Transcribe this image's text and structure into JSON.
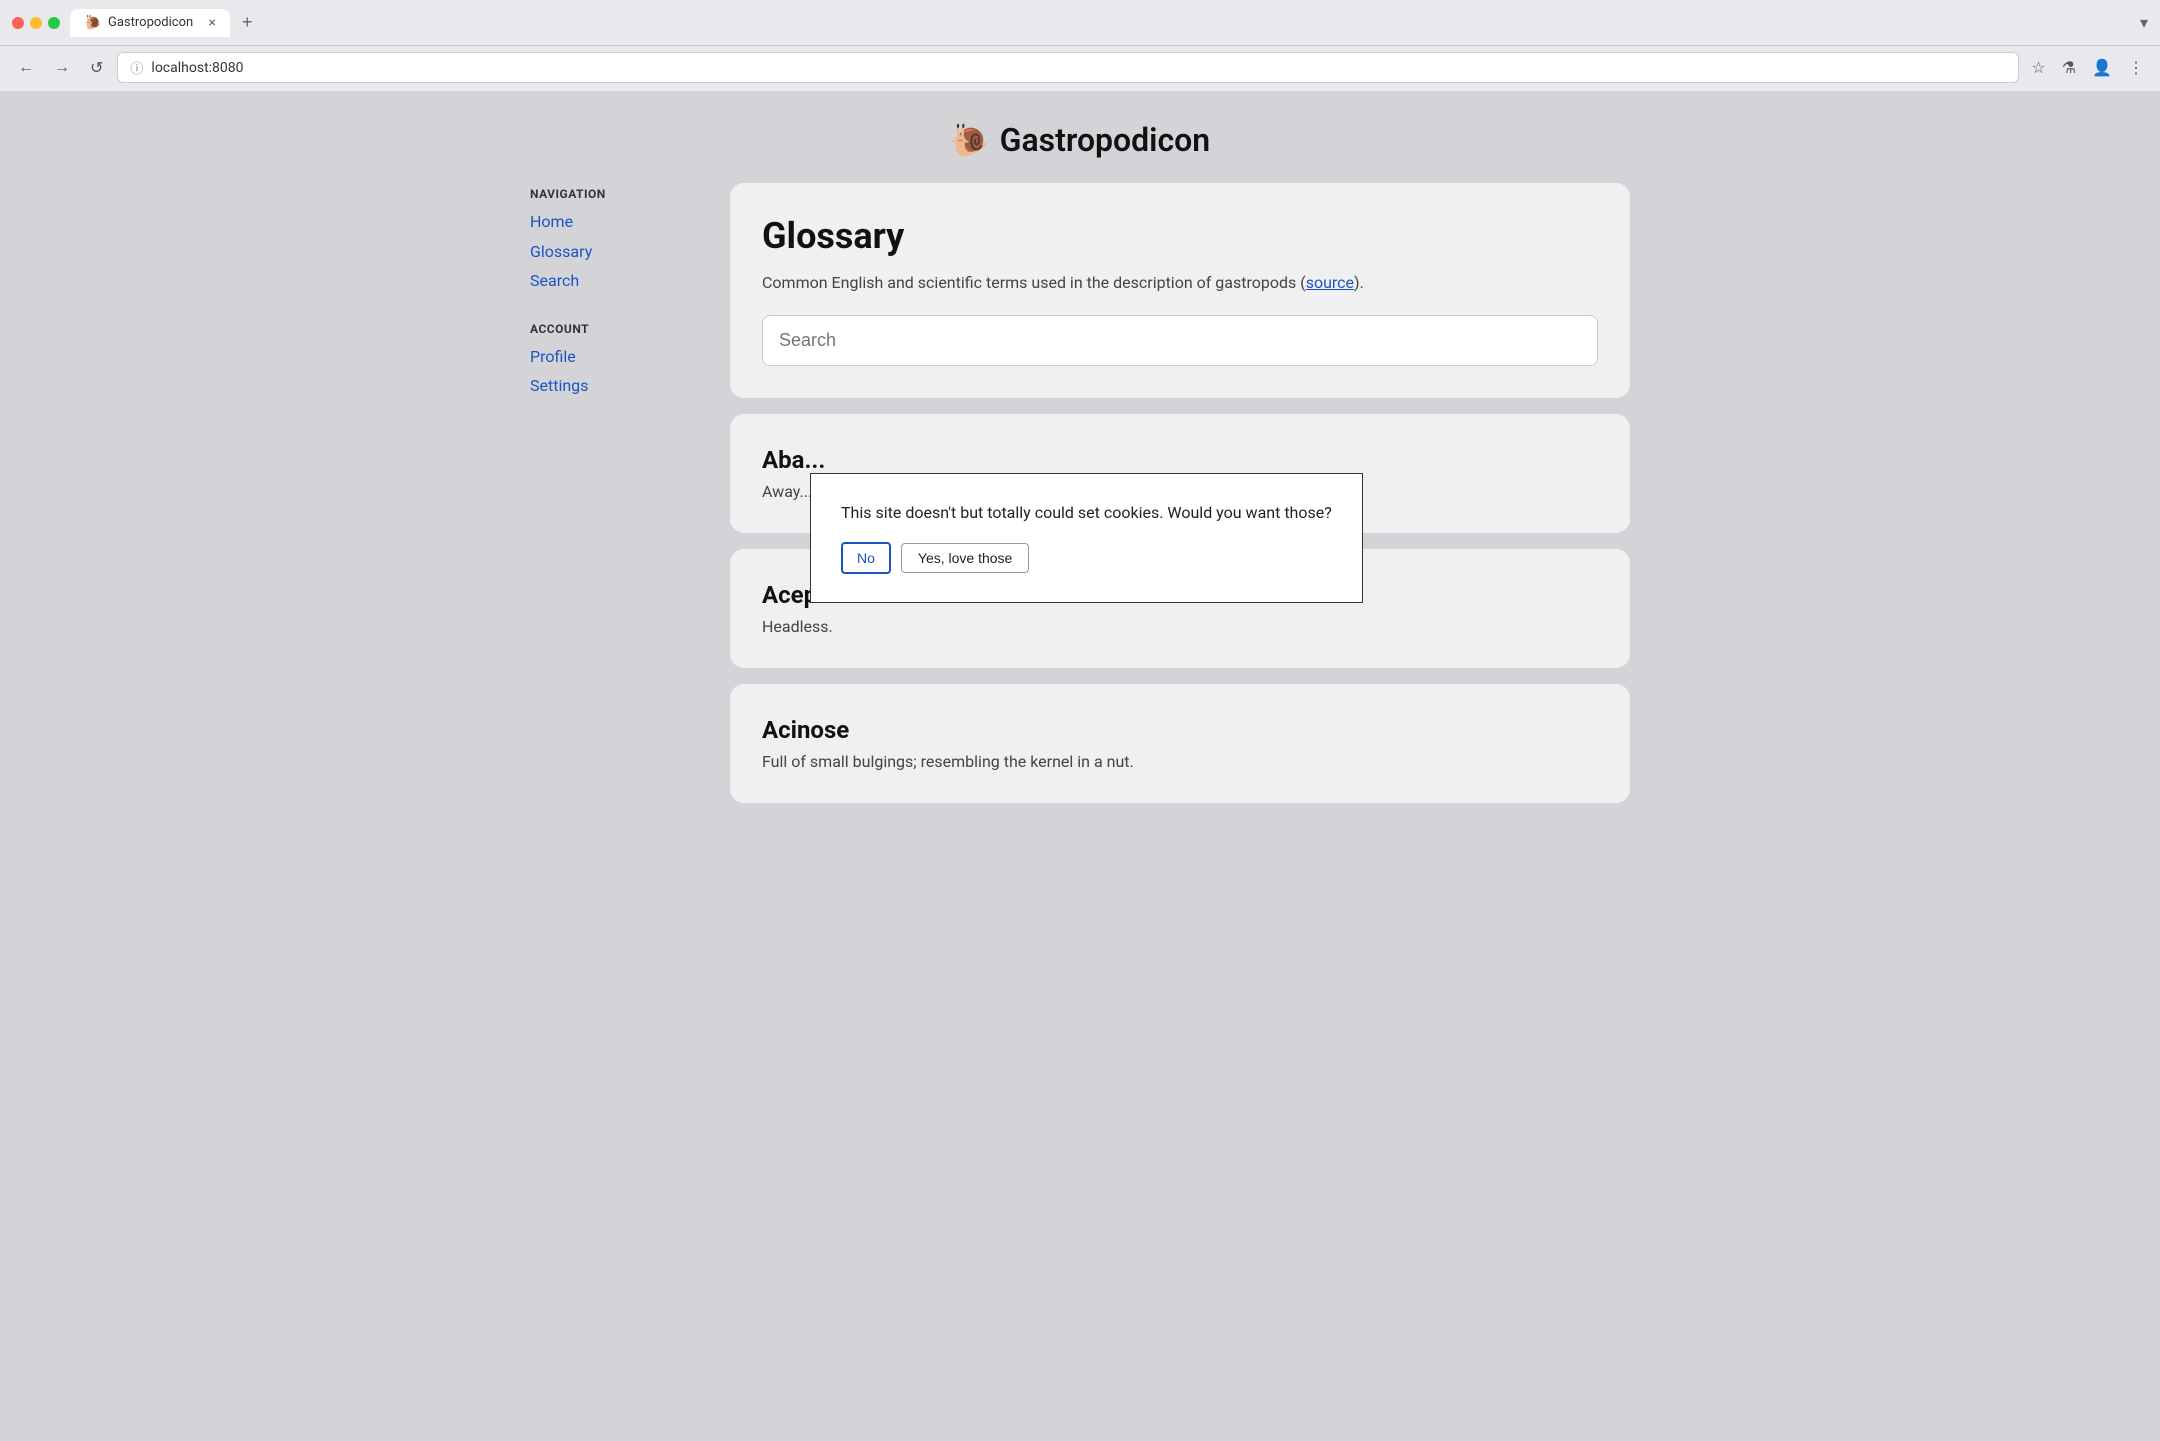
{
  "browser": {
    "tab_title": "Gastropodicon",
    "tab_favicon": "🐌",
    "url": "localhost:8080",
    "close_label": "×",
    "new_tab_label": "+",
    "tab_dropdown_label": "▾"
  },
  "nav_buttons": {
    "back": "←",
    "forward": "→",
    "reload": "↺",
    "info_icon": "ⓘ",
    "star_icon": "☆",
    "flask_icon": "⚗",
    "profile_icon": "👤",
    "menu_icon": "⋮"
  },
  "site": {
    "title": "Gastropodicon",
    "snail": "🐌"
  },
  "sidebar": {
    "navigation_label": "NAVIGATION",
    "account_label": "ACCOUNT",
    "nav_items": [
      {
        "label": "Home",
        "href": "#"
      },
      {
        "label": "Glossary",
        "href": "#"
      },
      {
        "label": "Search",
        "href": "#"
      }
    ],
    "account_items": [
      {
        "label": "Profile",
        "href": "#"
      },
      {
        "label": "Settings",
        "href": "#"
      }
    ]
  },
  "glossary": {
    "title": "Glossary",
    "description_before_link": "Common English and scientific terms used in the description of gastropods (",
    "description_link_text": "source",
    "description_after_link": ").",
    "search_placeholder": "Search",
    "terms": [
      {
        "term": "Aba...",
        "definition": "Away..."
      },
      {
        "term": "Acephalous",
        "definition": "Headless."
      },
      {
        "term": "Acinose",
        "definition": "Full of small bulgings; resembling the kernel in a nut."
      }
    ]
  },
  "cookie_dialog": {
    "message": "This site doesn't but totally could set cookies. Would you want those?",
    "btn_no": "No",
    "btn_yes": "Yes, love those"
  }
}
